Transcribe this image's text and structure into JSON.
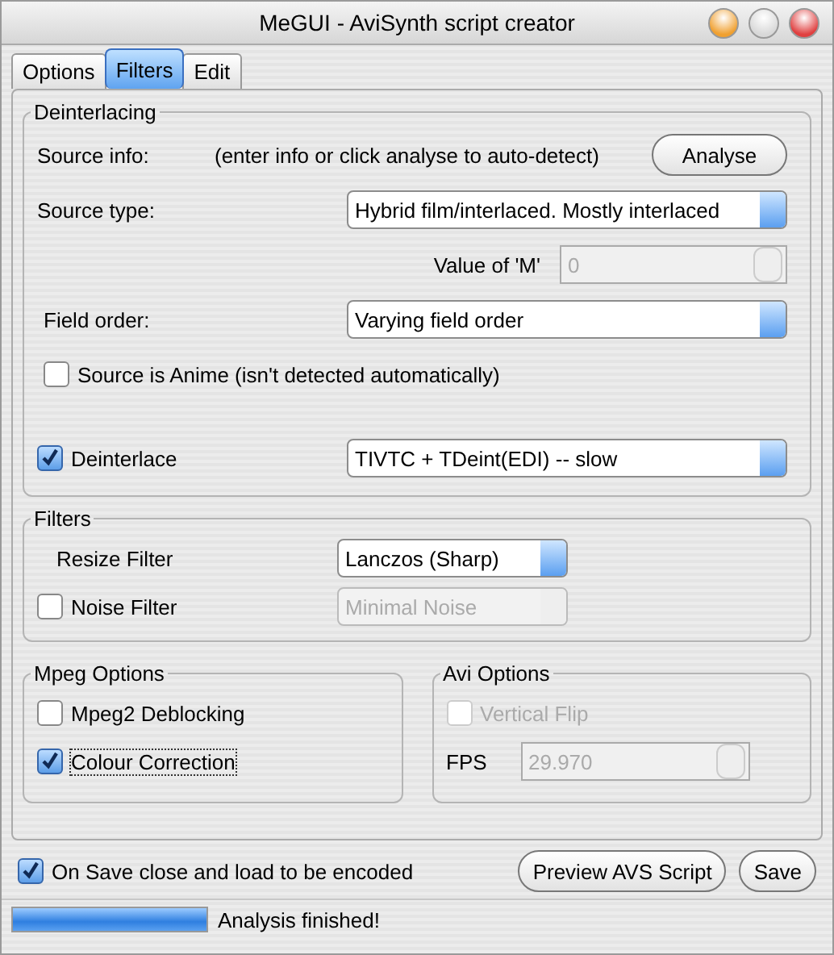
{
  "window": {
    "title": "MeGUI - AviSynth script creator"
  },
  "tabs": [
    {
      "label": "Options",
      "selected": false
    },
    {
      "label": "Filters",
      "selected": true
    },
    {
      "label": "Edit",
      "selected": false
    }
  ],
  "deinterlacing": {
    "title": "Deinterlacing",
    "source_info": {
      "label": "Source info:",
      "hint": "(enter info or click analyse to auto-detect)"
    },
    "analyse_button": "Analyse",
    "source_type": {
      "label": "Source type:",
      "value": "Hybrid film/interlaced. Mostly interlaced",
      "disabled": false
    },
    "value_m": {
      "label": "Value of 'M'",
      "value": "0",
      "disabled": true
    },
    "field_order": {
      "label": "Field order:",
      "value": "Varying field order",
      "disabled": false
    },
    "anime": {
      "label": "Source is Anime (isn't detected automatically)",
      "checked": false
    },
    "deinterlace": {
      "label": "Deinterlace",
      "checked": true,
      "value": "TIVTC + TDeint(EDI) -- slow",
      "disabled": false
    }
  },
  "filters": {
    "title": "Filters",
    "resize_filter": {
      "label": "Resize Filter",
      "value": "Lanczos (Sharp)",
      "disabled": false
    },
    "noise_filter": {
      "label": "Noise Filter",
      "checked": false,
      "value": "Minimal Noise",
      "disabled": true
    }
  },
  "mpeg_options": {
    "title": "Mpeg Options",
    "items": [
      {
        "label": "Mpeg2 Deblocking",
        "checked": false,
        "focused": false
      },
      {
        "label": "Colour Correction",
        "checked": true,
        "focused": true
      }
    ]
  },
  "avi_options": {
    "title": "Avi Options",
    "vertical_flip": {
      "label": "Vertical Flip",
      "checked": false,
      "disabled": true
    },
    "fps": {
      "label": "FPS",
      "value": "29.970",
      "disabled": true
    }
  },
  "on_save": {
    "label": "On Save close and load to be encoded",
    "checked": true
  },
  "buttons": [
    "Preview AVS Script",
    "Save"
  ],
  "status_bar": {
    "level": 1,
    "text": "Analysis finished!"
  }
}
